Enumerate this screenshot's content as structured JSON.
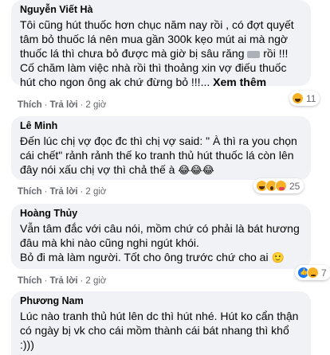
{
  "comments": [
    {
      "author": "Nguyễn Viết Hà",
      "text_1": "Tôi cũng hút thuốc hơn chục năm nay rồi , có đợt quyết tâm bỏ thuốc lá nên mua gần 300k kẹo mút ai mà ngờ thuốc lá thì chưa bỏ được mà giờ bị sâu răng",
      "text_2": " rồi !!!\nCố chăm làm việc nhà rồi thì thoảng xin vợ điếu thuốc hút cho ngon ông ak chứ đừng bỏ !!!... ",
      "see_more": "Xem thêm",
      "like": "Thích",
      "reply": "Trả lời",
      "time": "2 giờ",
      "reaction_count": "11",
      "reactions": [
        "haha"
      ]
    },
    {
      "author": "Lê Minh",
      "text": "Đến lúc chị vợ đọc đc thì chị vợ said: \" À thì ra you chọn cái chết\" rảnh rảnh thế ko tranh thủ hút thuốc lá còn lên đây nói xấu chị vợ thì chả thế à ",
      "emojis": "😂😂😂",
      "like": "Thích",
      "reply": "Trả lời",
      "time": "2 giờ",
      "reaction_count": "25",
      "reactions": [
        "haha",
        "wow",
        "care"
      ]
    },
    {
      "author": "Hoàng Thủy",
      "text": "Vẫn tâm đắc với câu nói, mồm chứ có phải là bát hương đâu mà khi nào cũng nghi ngút khói.\nBỏ đi mà làm người. Tốt cho ông trước chứ cho ai ",
      "emojis": "🙂",
      "like": "Thích",
      "reply": "Trả lời",
      "time": "2 giờ",
      "reaction_count": "7",
      "reactions": [
        "like",
        "sad"
      ]
    },
    {
      "author": "Phương Nam",
      "text": "Lúc nào tranh thủ hút lên dc thì hút nhé. Hút ko cẩn thận có ngày bị vk cho cái mồm thành cái bát nhang thì khổ\n:)))"
    }
  ]
}
